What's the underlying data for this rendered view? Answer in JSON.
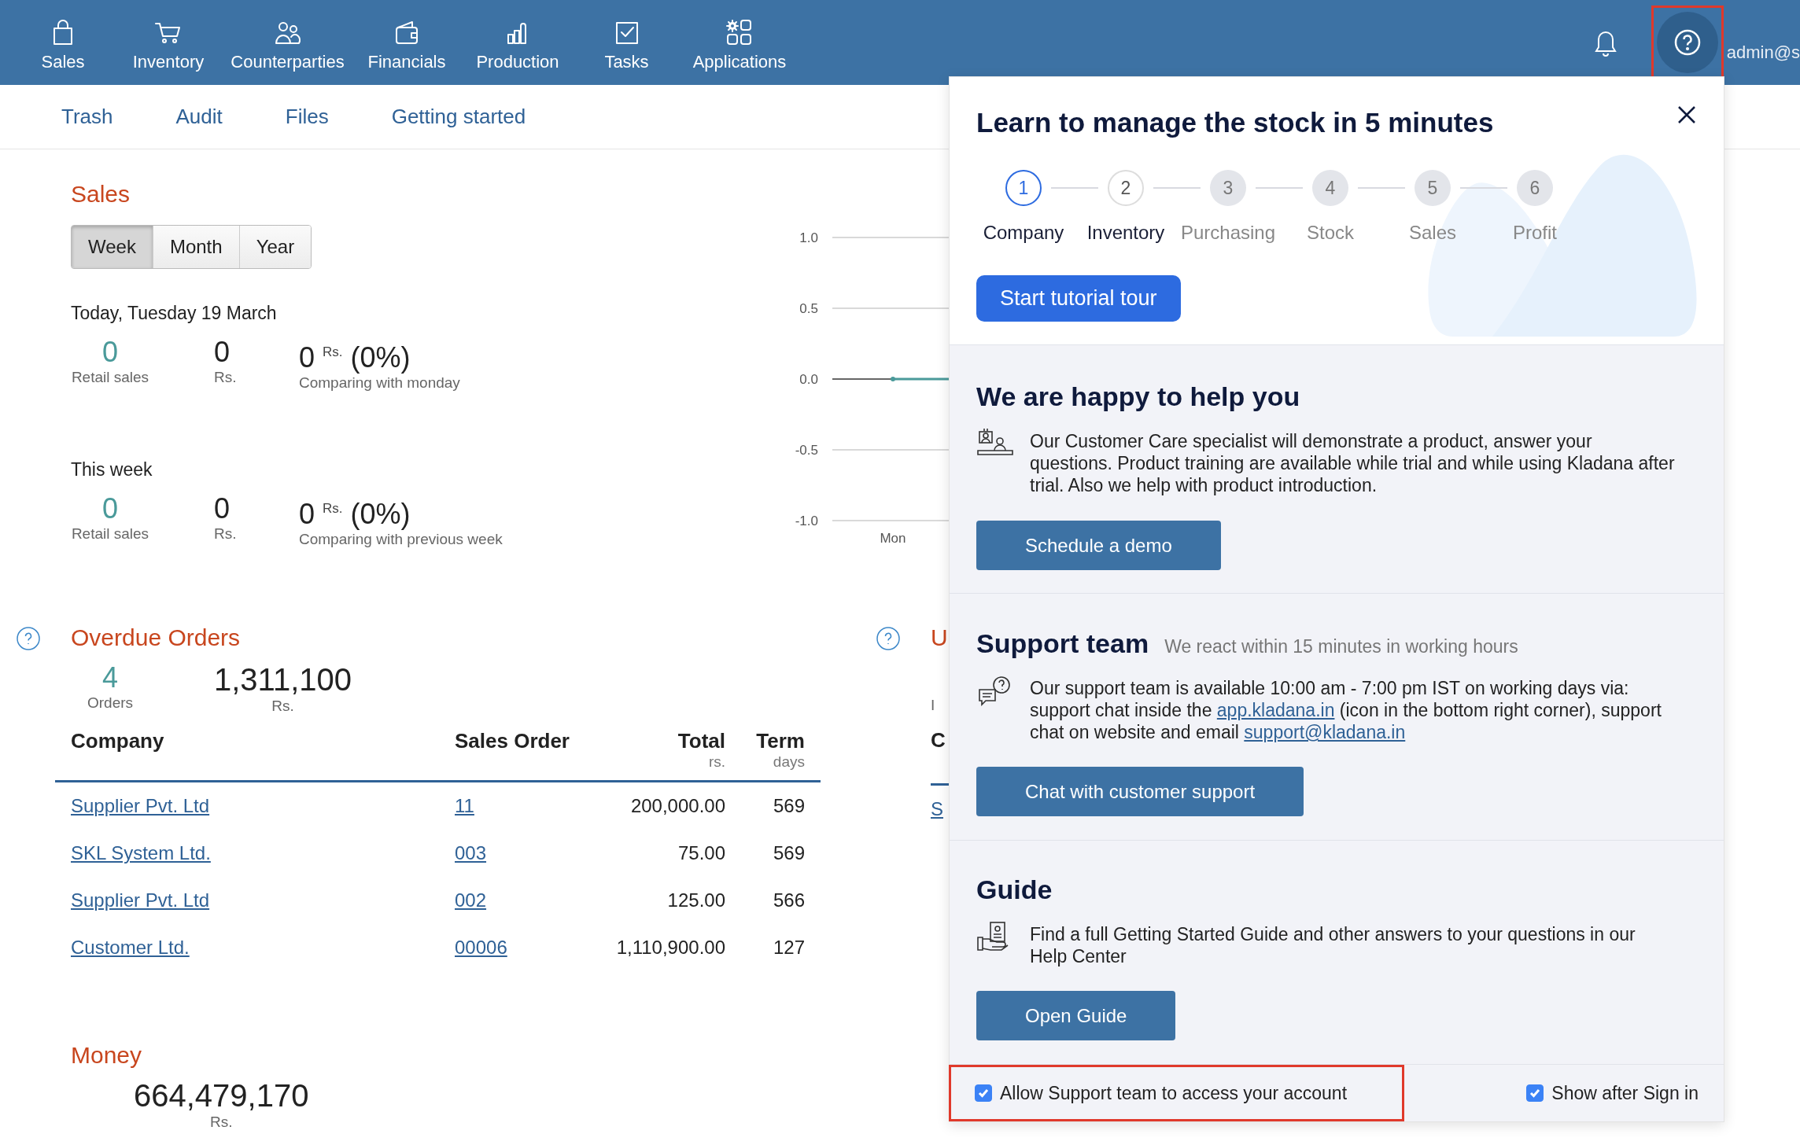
{
  "top_nav": {
    "items": [
      {
        "label": "Sales"
      },
      {
        "label": "Inventory"
      },
      {
        "label": "Counterparties"
      },
      {
        "label": "Financials"
      },
      {
        "label": "Production"
      },
      {
        "label": "Tasks"
      },
      {
        "label": "Applications"
      }
    ],
    "help_button": {
      "highlighted": true
    },
    "user": "admin@s"
  },
  "sub_nav": [
    "Trash",
    "Audit",
    "Files",
    "Getting started"
  ],
  "sales": {
    "title": "Sales",
    "periods": [
      {
        "label": "Week",
        "selected": true
      },
      {
        "label": "Month",
        "selected": false
      },
      {
        "label": "Year",
        "selected": false
      }
    ],
    "blocks": [
      {
        "heading": "Today, Tuesday 19 March",
        "count": "0",
        "count_label": "Retail sales",
        "amount": "0",
        "amount_label": "Rs.",
        "change": "0 $^{Rs.}$ (0%)",
        "change_label": "Comparing with monday"
      },
      {
        "heading": "This week",
        "count": "0",
        "count_label": "Retail sales",
        "amount": "0",
        "amount_label": "Rs.",
        "change": "0 $^{Rs.}$ (0%)",
        "change_label": "Comparing with previous week"
      }
    ],
    "chart_data": {
      "type": "line",
      "categories": [
        "Mon"
      ],
      "ylim": [
        -1,
        1
      ],
      "yticks": [
        {
          "value": 1,
          "label": "1.0"
        },
        {
          "value": 0.5,
          "label": "0.5"
        },
        {
          "value": 0,
          "label": "0.0"
        },
        {
          "value": -0.5,
          "label": "-0.5"
        },
        {
          "value": -1,
          "label": "-1.0"
        }
      ],
      "series": [
        {
          "color": "#4a9a9a",
          "marker": "circle",
          "values": [
            0
          ]
        }
      ]
    }
  },
  "overdue": {
    "title": "Overdue Orders",
    "count": "4",
    "count_label": "Orders",
    "amount": "1,311,100",
    "amount_label": "Rs.",
    "columns": [
      {
        "label": "Company"
      },
      {
        "label": "Sales Order"
      },
      {
        "label": "Total",
        "unit": "rs."
      },
      {
        "label": "Term",
        "unit": "days"
      }
    ],
    "rows": [
      [
        "Supplier Pvt. Ltd",
        "11",
        "200,000.00",
        "569"
      ],
      [
        "SKL System Ltd.",
        "003",
        "75.00",
        "569"
      ],
      [
        "Supplier Pvt. Ltd",
        "002",
        "125.00",
        "566"
      ],
      [
        "Customer Ltd.",
        "00006",
        "1,110,900.00",
        "127"
      ]
    ]
  },
  "next_widget": {
    "title": "U",
    "label": "I",
    "column": "C",
    "link": "S"
  },
  "money": {
    "title": "Money",
    "amount": "664,479,170",
    "amount_label": "Rs."
  },
  "help_panel": {
    "title": "Learn to manage the stock in 5 minutes",
    "steps": [
      {
        "number": "1",
        "label": "Company",
        "selected": true,
        "disabled": false
      },
      {
        "number": "2",
        "label": "Inventory",
        "selected": false,
        "disabled": false
      },
      {
        "number": "3",
        "label": "Purchasing",
        "selected": false,
        "disabled": true
      },
      {
        "number": "4",
        "label": "Stock",
        "selected": false,
        "disabled": true
      },
      {
        "number": "5",
        "label": "Sales",
        "selected": false,
        "disabled": true
      },
      {
        "number": "6",
        "label": "Profit",
        "selected": false,
        "disabled": true
      }
    ],
    "tour_button": "Start tutorial tour",
    "sections": [
      {
        "title": "We are happy to help you",
        "text": [
          {
            "text": "Our Customer Care specialist will demonstrate a product, answer your questions. Product training are available while trial and while using Kladana after trial. Also we help with product introduction."
          }
        ],
        "button": "Schedule a demo"
      },
      {
        "title": "Support team",
        "subtitle": "We react within 15 minutes in working hours",
        "text": [
          {
            "text": "Our support team is available 10:00 am - 7:00 pm IST on working days via: support chat inside the "
          },
          {
            "text": "app.kladana.in",
            "kind": "link"
          },
          {
            "text": " (icon in the bottom right corner), support chat on website and email "
          },
          {
            "text": "support@kladana.in",
            "kind": "link"
          }
        ],
        "button": "Chat with customer support"
      },
      {
        "title": "Guide",
        "text": [
          {
            "text": "Find a full Getting Started Guide and other answers to your questions in our Help Center"
          }
        ],
        "button": "Open Guide"
      }
    ],
    "allow_access": {
      "label": "Allow Support team to access your account",
      "checked": true,
      "highlighted": true
    },
    "show_after_sign_in": {
      "label": "Show after Sign in",
      "checked": true
    }
  }
}
